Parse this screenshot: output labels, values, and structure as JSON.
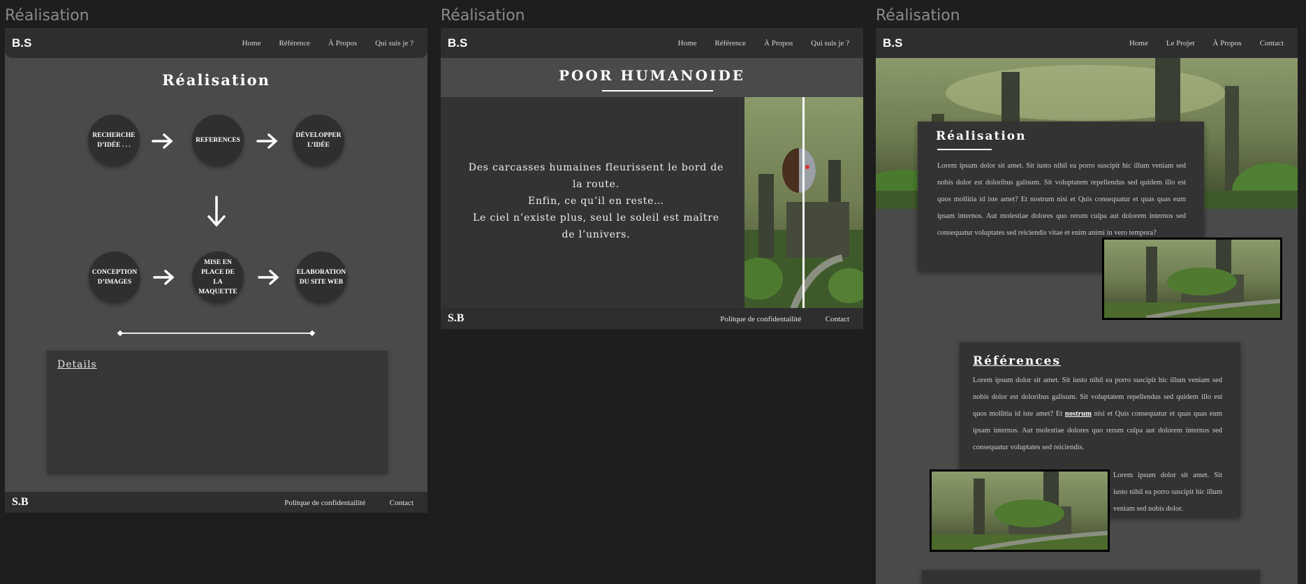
{
  "frames": [
    {
      "label": "Réalisation"
    },
    {
      "label": "Réalisation"
    },
    {
      "label": "Réalisation"
    }
  ],
  "frame1": {
    "logo": "B.S",
    "nav": [
      "Home",
      "Référence",
      "À Propos",
      "Qui suis je ?"
    ],
    "title": "Réalisation",
    "steps": [
      "RECHERCHE D’IDÉE . . .",
      "REFERENCES",
      "DÉVELOPPER L’IDÉE",
      "CONCEPTION D’IMAGES",
      "MISE EN PLACE DE LA MAQUETTE",
      "ELABORATION DU SITE WEB"
    ],
    "details_label": "Details",
    "footer": {
      "logo": "S.B",
      "links": [
        "Politque de confidentailité",
        "Contact"
      ]
    }
  },
  "frame2": {
    "logo": "B.S",
    "nav": [
      "Home",
      "Référence",
      "À Propos",
      "Qui suis je ?"
    ],
    "title": "POOR HUMANOIDE",
    "lines": [
      "Des carcasses humaines fleurissent le bord de la route.",
      "Enfin, ce qu’il en reste…",
      "Le ciel n’existe plus, seul le soleil est maître de l’univers."
    ],
    "footer": {
      "logo": "S.B",
      "links": [
        "Politque de confidentailité",
        "Contact"
      ]
    }
  },
  "frame3": {
    "logo": "B.S",
    "nav": [
      "Home",
      "Le Projet",
      "À Propos",
      "Contact"
    ],
    "card1_title": "Réalisation",
    "card1_text": "Lorem ipsum dolor sit amet. Sit iusto nihil ea porro suscipit hic illum veniam sed nobis dolor est doloribus galisum. Sit voluptatem repellendus sed quidem illo est quos mollitia id iste amet? Et nostrum nisi et Quis consequatur et quas quas eum ipsam internos. Aut molestiae dolores quo rerum culpa aut dolorem internos sed consequatur voluptates sed reiciendis vitae et enim animi in vero tempora?",
    "card2_title": "Références",
    "card2_text_a": "Lorem ipsum dolor sit amet. Sit iusto nihil ea porro suscipit hic illum veniam sed nobis dolor est doloribus galisum. Sit voluptatem repellendus sed quidem illo est quos mollitia id iste amet? Et",
    "card2_bold": "nostrum",
    "card2_text_b": "nisi et Quis consequatur et quas quas eum ipsam internos. Aut molestiae dolores quo rerum culpa aut dolorem internos sed consequatur voluptates sed reiciendis.",
    "card2_text_c": "Lorem ipsum dolor sit amet. Sit iusto nihil ea porro suscipit hic illum veniam sed nobis dolor."
  },
  "colors": {
    "background": "#1e1e1e",
    "panel": "#4a4a4a",
    "nav": "#2e2e2e",
    "card": "#333333"
  }
}
